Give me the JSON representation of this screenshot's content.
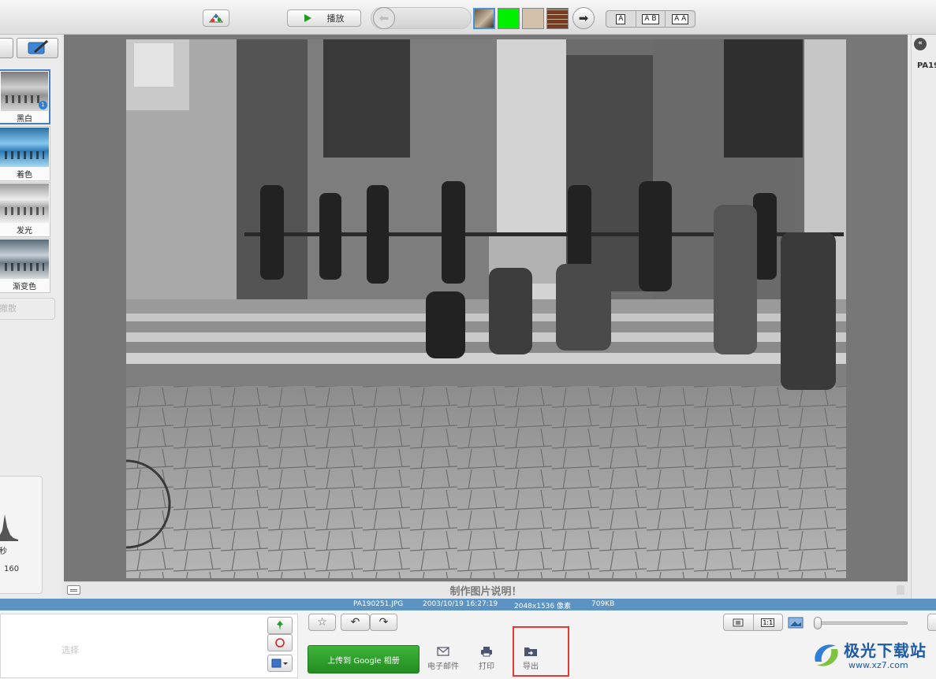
{
  "toolbar": {
    "play_label": "播放",
    "text_styles": [
      "A",
      "A B",
      "A A"
    ]
  },
  "effects": [
    {
      "label": "黑白",
      "badge": "1",
      "selected": true
    },
    {
      "label": "着色"
    },
    {
      "label": "发光"
    },
    {
      "label": "渐变色"
    }
  ],
  "left_panel": {
    "undo_label": "撤散",
    "histogram_exposure": "秒",
    "histogram_iso": "160"
  },
  "viewer": {
    "caption_placeholder": "制作图片说明！"
  },
  "right_panel": {
    "filename_prefix": "PA19"
  },
  "info_bar": {
    "filename": "PA190251.JPG",
    "datetime": "2003/10/19 16:27:19",
    "dimensions": "2048x1536 像素",
    "filesize": "709KB"
  },
  "bottom": {
    "tray_label": "选择",
    "upload_label": "上传到 Google 相册",
    "email_label": "电子邮件",
    "print_label": "打印",
    "export_label": "导出",
    "view_buttons": [
      "",
      "1:1"
    ]
  },
  "watermark": {
    "title": "极光下载站",
    "url": "www.xz7.com"
  },
  "colors": {
    "info_bar": "#5d93c2",
    "upload_green": "#2f9e2c",
    "highlight_red": "#e03a33",
    "watermark_blue": "#1d5ba6"
  }
}
